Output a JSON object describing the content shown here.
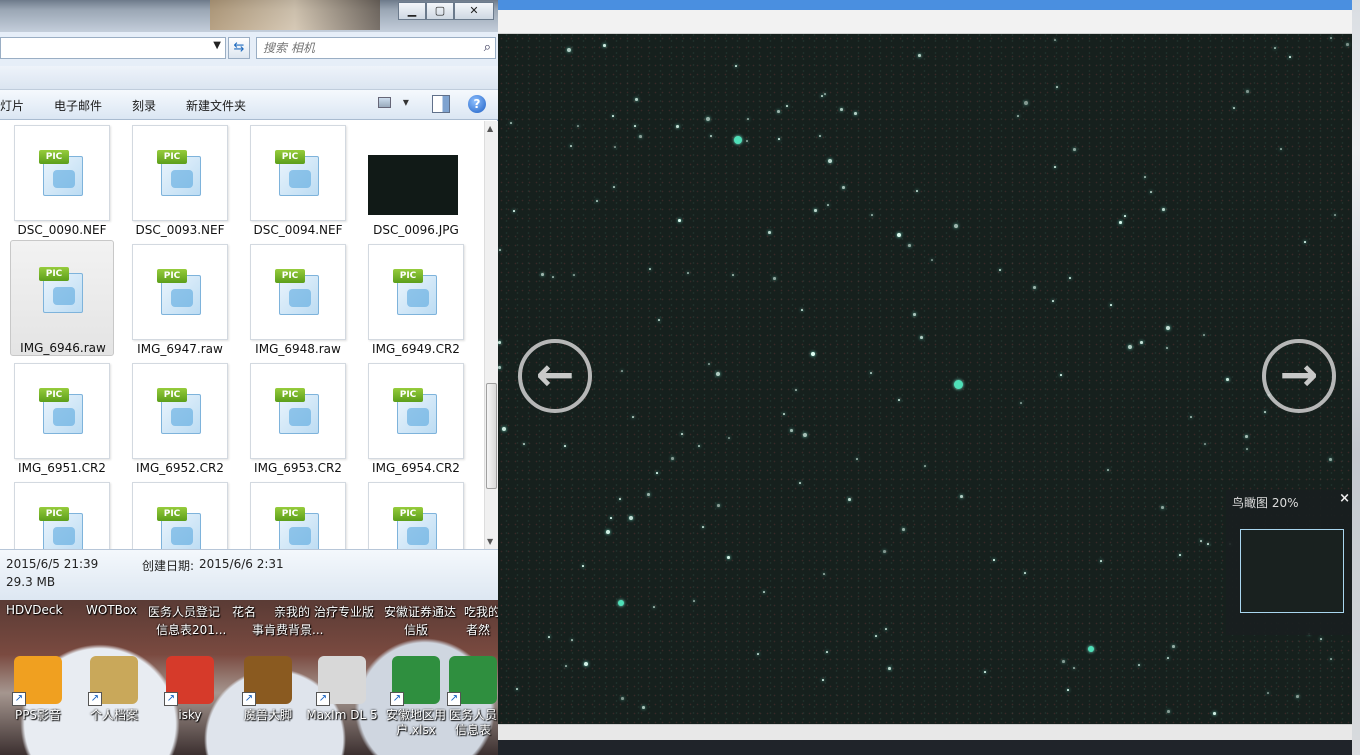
{
  "explorer": {
    "search_placeholder": "搜索 相机",
    "toolbar": [
      "灯片",
      "电子邮件",
      "刻录",
      "新建文件夹"
    ],
    "view_label": "▾",
    "files": [
      {
        "name": "DSC_0090.NEF",
        "tag": "PIC",
        "type": "pic"
      },
      {
        "name": "DSC_0093.NEF",
        "tag": "PIC",
        "type": "pic"
      },
      {
        "name": "DSC_0094.NEF",
        "tag": "PIC",
        "type": "pic"
      },
      {
        "name": "DSC_0096.JPG",
        "tag": "",
        "type": "photo"
      },
      {
        "name": "IMG_6946.raw",
        "tag": "PIC",
        "type": "pic",
        "selected": true
      },
      {
        "name": "IMG_6947.raw",
        "tag": "PIC",
        "type": "pic"
      },
      {
        "name": "IMG_6948.raw",
        "tag": "PIC",
        "type": "pic"
      },
      {
        "name": "IMG_6949.CR2",
        "tag": "PIC",
        "type": "pic"
      },
      {
        "name": "IMG_6951.CR2",
        "tag": "PIC",
        "type": "pic"
      },
      {
        "name": "IMG_6952.CR2",
        "tag": "PIC",
        "type": "pic"
      },
      {
        "name": "IMG_6953.CR2",
        "tag": "PIC",
        "type": "pic"
      },
      {
        "name": "IMG_6954.CR2",
        "tag": "PIC",
        "type": "pic"
      },
      {
        "name": "",
        "tag": "PIC",
        "type": "pic"
      },
      {
        "name": "",
        "tag": "PIC",
        "type": "pic"
      },
      {
        "name": "",
        "tag": "PIC",
        "type": "pic"
      },
      {
        "name": "",
        "tag": "PIC",
        "type": "pic"
      }
    ],
    "details": {
      "modified": "2015/6/5 21:39",
      "created_label": "创建日期:",
      "created": "2015/6/6 2:31",
      "size": "29.3 MB"
    }
  },
  "desktop": {
    "row_labels": [
      "HDVDeck",
      "WOTBox",
      "医务人员登记",
      "花名",
      "亲我的",
      "治疗专业版",
      "安徽证券通达",
      "吃我的",
      "信息表201...",
      "事肯费背景...",
      "信版",
      "者然"
    ],
    "icons": [
      {
        "label": "PPS影音",
        "color": "#f0a020"
      },
      {
        "label": "个人档案",
        "color": "#c9a85a"
      },
      {
        "label": "isky",
        "color": "#d63a2a"
      },
      {
        "label": "魔兽大脚",
        "color": "#8a5a20"
      },
      {
        "label": "MaxIm DL 5",
        "color": "#d8d8d8"
      },
      {
        "label": "安徽地区用户.xlsx",
        "color": "#2f8f3f"
      },
      {
        "label": "医务人员信息表",
        "color": "#2f8f3f"
      }
    ]
  },
  "viewer": {
    "prev_arrow": "←",
    "next_arrow": "→",
    "birdseye_label": "鸟瞰图 20%",
    "birdseye_close": "×"
  }
}
